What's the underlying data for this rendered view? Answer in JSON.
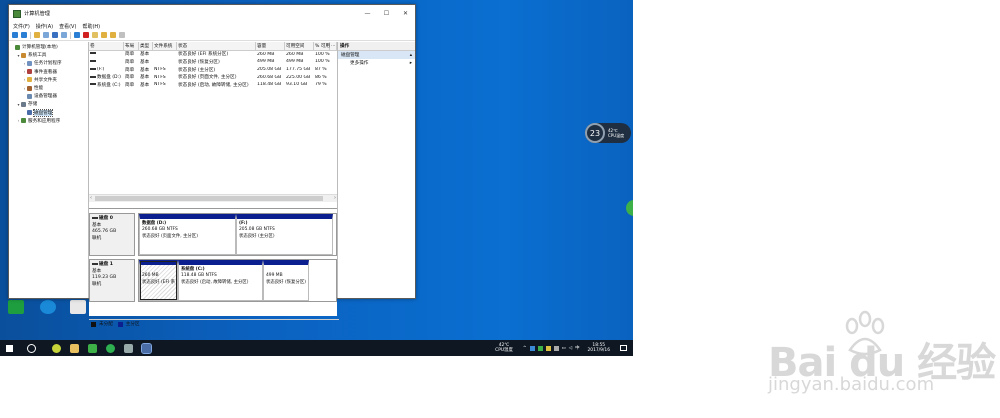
{
  "window": {
    "title": "计算机管理",
    "minimize": "—",
    "maximize": "☐",
    "close": "✕"
  },
  "menu": [
    "文件(F)",
    "操作(A)",
    "查看(V)",
    "帮助(H)"
  ],
  "tree": [
    {
      "label": "计算机管理(本地)",
      "level": 0,
      "arrow": ""
    },
    {
      "label": "系统工具",
      "level": 1,
      "arrow": "▾"
    },
    {
      "label": "任务计划程序",
      "level": 2,
      "arrow": "›"
    },
    {
      "label": "事件查看器",
      "level": 2,
      "arrow": "›"
    },
    {
      "label": "共享文件夹",
      "level": 2,
      "arrow": "›"
    },
    {
      "label": "性能",
      "level": 2,
      "arrow": "›"
    },
    {
      "label": "设备管理器",
      "level": 2,
      "arrow": ""
    },
    {
      "label": "存储",
      "level": 1,
      "arrow": "▾"
    },
    {
      "label": "磁盘管理",
      "level": 2,
      "arrow": "",
      "selected": true
    },
    {
      "label": "服务和应用程序",
      "level": 1,
      "arrow": "›"
    }
  ],
  "table": {
    "headers": [
      "卷",
      "布局",
      "类型",
      "文件系统",
      "状态",
      "容量",
      "可用空间",
      "% 可用",
      "..."
    ],
    "rows": [
      [
        "",
        "简单",
        "基本",
        "",
        "状态良好 (EFI 系统分区)",
        "260 MB",
        "260 MB",
        "100 %"
      ],
      [
        "",
        "简单",
        "基本",
        "",
        "状态良好 (恢复分区)",
        "499 MB",
        "499 MB",
        "100 %"
      ],
      [
        "(F:)",
        "简单",
        "基本",
        "NTFS",
        "状态良好 (主分区)",
        "205.08 GB",
        "177.75 GB",
        "87 %"
      ],
      [
        "数据盘 (D:)",
        "简单",
        "基本",
        "NTFS",
        "状态良好 (页面文件, 主分区)",
        "260.68 GB",
        "225.00 GB",
        "86 %"
      ],
      [
        "系统盘 (C:)",
        "简单",
        "基本",
        "NTFS",
        "状态良好 (启动, 故障转储, 主分区)",
        "118.48 GB",
        "93.10 GB",
        "79 %"
      ]
    ]
  },
  "disks": [
    {
      "name": "磁盘 0",
      "type": "基本",
      "size": "465.76 GB",
      "status": "联机",
      "partitions": [
        {
          "title": "数据盘 (D:)",
          "size": "260.68 GB NTFS",
          "status": "状态良好 (页面文件, 主分区)"
        },
        {
          "title": "(F:)",
          "size": "205.08 GB NTFS",
          "status": "状态良好 (主分区)"
        }
      ]
    },
    {
      "name": "磁盘 1",
      "type": "基本",
      "size": "119.23 GB",
      "status": "联机",
      "partitions": [
        {
          "title": "",
          "size": "260 MB",
          "status": "状态良好 (EFI 系"
        },
        {
          "title": "系统盘 (C:)",
          "size": "118.48 GB NTFS",
          "status": "状态良好 (启动, 故障转储, 主分区)"
        },
        {
          "title": "",
          "size": "499 MB",
          "status": "状态良好 (恢复分区)"
        }
      ]
    }
  ],
  "legend": [
    "未分配",
    "主分区"
  ],
  "actions": {
    "header": "操作",
    "selected": "磁盘管理",
    "more": "更多操作"
  },
  "gadget": {
    "value": "23",
    "temp": "42℃",
    "label": "CPU温度"
  },
  "tray": {
    "temp": "42℃",
    "temp_label": "CPU温度",
    "time": "18:55",
    "date": "2017/9/16"
  },
  "watermark": {
    "brand": "Bai du 经验",
    "url": "jingyan.baidu.com"
  },
  "colors": {
    "primary_partition": "#0b1f8e",
    "desktop": "#0b61bf",
    "taskbar": "#0e1722"
  }
}
